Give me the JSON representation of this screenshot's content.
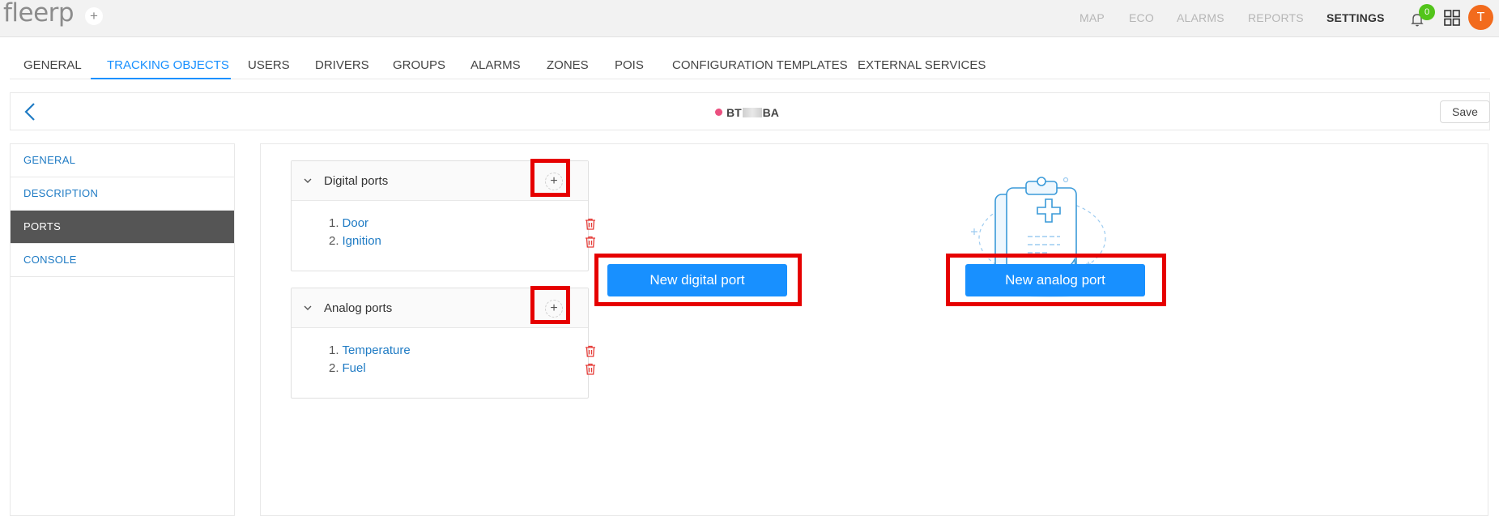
{
  "header": {
    "logo": "fleerp",
    "logo_add": "+",
    "nav": [
      {
        "label": "MAP",
        "active": false
      },
      {
        "label": "ECO",
        "active": false
      },
      {
        "label": "ALARMS",
        "active": false
      },
      {
        "label": "REPORTS",
        "active": false
      },
      {
        "label": "SETTINGS",
        "active": true
      }
    ],
    "notifications_count": "0",
    "avatar_initial": "T"
  },
  "tabs": [
    {
      "label": "GENERAL",
      "active": false
    },
    {
      "label": "TRACKING OBJECTS",
      "active": true
    },
    {
      "label": "USERS",
      "active": false
    },
    {
      "label": "DRIVERS",
      "active": false
    },
    {
      "label": "GROUPS",
      "active": false
    },
    {
      "label": "ALARMS",
      "active": false
    },
    {
      "label": "ZONES",
      "active": false
    },
    {
      "label": "POIS",
      "active": false
    },
    {
      "label": "CONFIGURATION TEMPLATES",
      "active": false
    },
    {
      "label": "EXTERNAL SERVICES",
      "active": false
    }
  ],
  "object": {
    "title_prefix": "BT",
    "title_suffix": "BA",
    "status_color": "#eb5080",
    "save_label": "Save"
  },
  "sidebar": {
    "items": [
      {
        "label": "GENERAL",
        "active": false
      },
      {
        "label": "DESCRIPTION",
        "active": false
      },
      {
        "label": "PORTS",
        "active": true
      },
      {
        "label": "CONSOLE",
        "active": false
      }
    ]
  },
  "ports": {
    "digital": {
      "title": "Digital ports",
      "add": "+",
      "items": [
        {
          "num": "1.",
          "name": "Door"
        },
        {
          "num": "2.",
          "name": "Ignition"
        }
      ]
    },
    "analog": {
      "title": "Analog ports",
      "add": "+",
      "items": [
        {
          "num": "1.",
          "name": "Temperature"
        },
        {
          "num": "2.",
          "name": "Fuel"
        }
      ]
    }
  },
  "actions": {
    "new_digital": "New digital port",
    "new_analog": "New analog port"
  },
  "colors": {
    "accent": "#1890ff",
    "active_menu": "#555555",
    "highlight": "#e60000",
    "delete": "#e53935"
  }
}
